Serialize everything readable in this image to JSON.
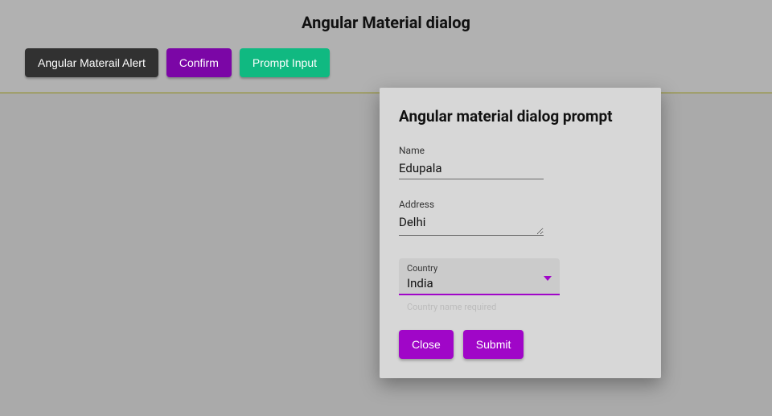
{
  "header": {
    "title": "Angular Material dialog"
  },
  "buttons": {
    "alert": "Angular Materail Alert",
    "confirm": "Confirm",
    "prompt": "Prompt Input"
  },
  "dialog": {
    "title": "Angular material dialog prompt",
    "fields": {
      "name": {
        "label": "Name",
        "value": "Edupala"
      },
      "address": {
        "label": "Address",
        "value": "Delhi"
      },
      "country": {
        "label": "Country",
        "value": "India",
        "hint": "Country name required"
      }
    },
    "actions": {
      "close": "Close",
      "submit": "Submit"
    }
  },
  "colors": {
    "accent": "#a006c8",
    "teal": "#10b981",
    "dark": "#313131"
  }
}
